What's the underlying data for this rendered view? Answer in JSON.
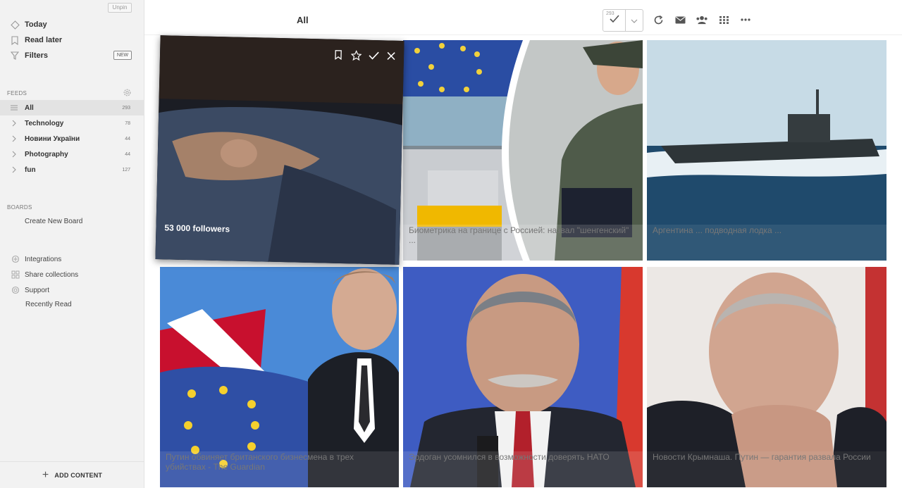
{
  "sidebar": {
    "unpin_label": "Unpin",
    "nav": [
      {
        "label": "Today",
        "icon": "today-icon"
      },
      {
        "label": "Read later",
        "icon": "bookmark-icon"
      },
      {
        "label": "Filters",
        "icon": "filter-icon"
      }
    ],
    "filters_badge": "NEW",
    "feeds_label": "FEEDS",
    "feeds": [
      {
        "label": "All",
        "count": "293",
        "icon": "list-icon"
      },
      {
        "label": "Technology",
        "count": "78",
        "icon": "chevron-right-icon"
      },
      {
        "label": "Новини України",
        "count": "44",
        "icon": "chevron-right-icon"
      },
      {
        "label": "Photography",
        "count": "44",
        "icon": "chevron-right-icon"
      },
      {
        "label": "fun",
        "count": "127",
        "icon": "chevron-right-icon"
      }
    ],
    "boards_label": "BOARDS",
    "create_board": "Create New Board",
    "bottom": [
      {
        "label": "Integrations",
        "icon": "integrations-icon"
      },
      {
        "label": "Share collections",
        "icon": "share-collections-icon"
      },
      {
        "label": "Support",
        "icon": "support-icon"
      }
    ],
    "recently_read": "Recently Read",
    "add_content": "ADD CONTENT"
  },
  "header": {
    "title": "All",
    "unread_count": "293",
    "icons": [
      "checkmark-icon",
      "chevron-down-icon",
      "refresh-icon",
      "mail-icon",
      "team-icon",
      "grid-view-icon",
      "more-icon"
    ]
  },
  "tiles": [
    {
      "caption": "53 000 followers"
    },
    {
      "caption": "Биометрика на границе с Россией: назвал \"шенгенский\" ..."
    },
    {
      "caption": "Аргентина ... подводная лодка ..."
    },
    {
      "caption": "Путин обвиняет британского бизнесмена в трех убийствах - The Guardian"
    },
    {
      "caption": "Эрдоган усомнился в возможности доверять НАТО"
    },
    {
      "caption": "Новости Крымнаша. Путин — гарантия развала России"
    }
  ],
  "colors": {
    "sidebar_bg": "#f2f2f2",
    "active_row": "#e3e3e3"
  }
}
